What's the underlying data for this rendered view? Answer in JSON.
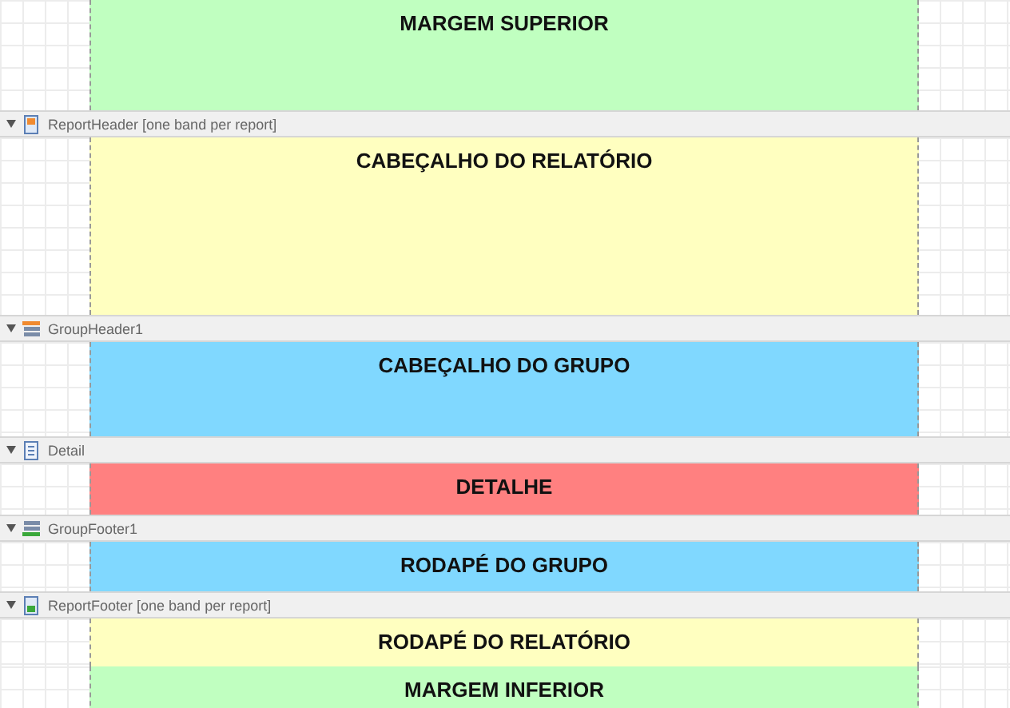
{
  "bands": [
    {
      "content": {
        "text": "MARGEM SUPERIOR",
        "color": "#c0ffc0"
      }
    },
    {
      "header": {
        "kind": "report-header",
        "label": "ReportHeader [one band per report]",
        "expanded": true
      },
      "content": {
        "text": "CABEÇALHO DO RELATÓRIO",
        "color": "#ffffc0"
      }
    },
    {
      "header": {
        "kind": "group-header",
        "label": "GroupHeader1",
        "expanded": true
      },
      "content": {
        "text": "CABEÇALHO DO GRUPO",
        "color": "#80d8ff"
      }
    },
    {
      "header": {
        "kind": "detail",
        "label": "Detail",
        "expanded": true
      },
      "content": {
        "text": "DETALHE",
        "color": "#ff8080"
      }
    },
    {
      "header": {
        "kind": "group-footer",
        "label": "GroupFooter1",
        "expanded": true
      },
      "content": {
        "text": "RODAPÉ DO GRUPO",
        "color": "#80d8ff"
      }
    },
    {
      "header": {
        "kind": "report-footer",
        "label": "ReportFooter [one band per report]",
        "expanded": true
      },
      "content": {
        "text": "RODAPÉ DO RELATÓRIO",
        "color": "#ffffc0"
      }
    },
    {
      "content": {
        "text": "MARGEM INFERIOR",
        "color": "#c0ffc0"
      }
    }
  ]
}
